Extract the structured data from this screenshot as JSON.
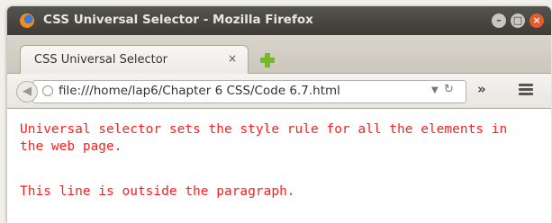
{
  "window": {
    "title": "CSS Universal Selector - Mozilla Firefox"
  },
  "tab": {
    "label": "CSS Universal Selector",
    "close_symbol": "×"
  },
  "navbar": {
    "url": "file:///home/lap6/Chapter 6 CSS/Code 6.7.html",
    "overflow_symbol": "»"
  },
  "content": {
    "paragraph": "Universal selector sets the style rule for all the elements in the web page.",
    "outside_line": "This line is outside the paragraph.",
    "text_color": "#ff1e1e"
  },
  "colors": {
    "titlebar": "#3c3b37",
    "close_button": "#e75a2a",
    "new_tab": "#76b82a"
  },
  "icons": [
    "firefox-logo-icon",
    "minimize-icon",
    "maximize-icon",
    "close-icon",
    "tab-close-icon",
    "new-tab-icon",
    "back-arrow-icon",
    "globe-icon",
    "dropdown-icon",
    "reload-icon",
    "overflow-icon",
    "menu-icon"
  ]
}
